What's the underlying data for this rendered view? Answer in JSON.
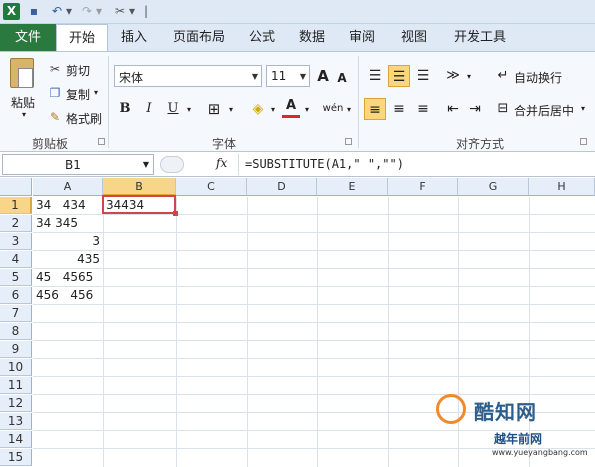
{
  "qat": {
    "excel_logo": "X",
    "dropdown_glyph": "▾",
    "separator_glyph": "|"
  },
  "tabs": [
    "文件",
    "开始",
    "插入",
    "页面布局",
    "公式",
    "数据",
    "审阅",
    "视图",
    "开发工具"
  ],
  "ribbon": {
    "clipboard": {
      "paste": "粘贴",
      "cut": "剪切",
      "copy": "复制",
      "format_painter": "格式刷",
      "label": "剪贴板"
    },
    "font": {
      "name": "宋体",
      "size": "11",
      "grow": "A",
      "shrink": "A",
      "bold": "B",
      "italic": "I",
      "underline": "U",
      "label": "字体"
    },
    "alignment": {
      "wrap": "自动换行",
      "merge": "合并后居中",
      "label": "对齐方式"
    }
  },
  "formula_bar": {
    "name_box": "B1",
    "fx": "fx",
    "formula": "=SUBSTITUTE(A1,\" \",\"\")"
  },
  "columns": [
    "A",
    "B",
    "C",
    "D",
    "E",
    "F",
    "G",
    "H"
  ],
  "rows": [
    "1",
    "2",
    "3",
    "4",
    "5",
    "6",
    "7",
    "8",
    "9",
    "10",
    "11",
    "12",
    "13",
    "14",
    "15"
  ],
  "cells": {
    "A1": "34   434",
    "B1": "34434",
    "A2": "34 345",
    "A3": "3",
    "A4": "435",
    "A5": "45   4565",
    "A6": "456   456"
  },
  "watermark": {
    "name": "酷知网",
    "site_name": "越年前网",
    "url": "www.yueyangbang.com"
  }
}
